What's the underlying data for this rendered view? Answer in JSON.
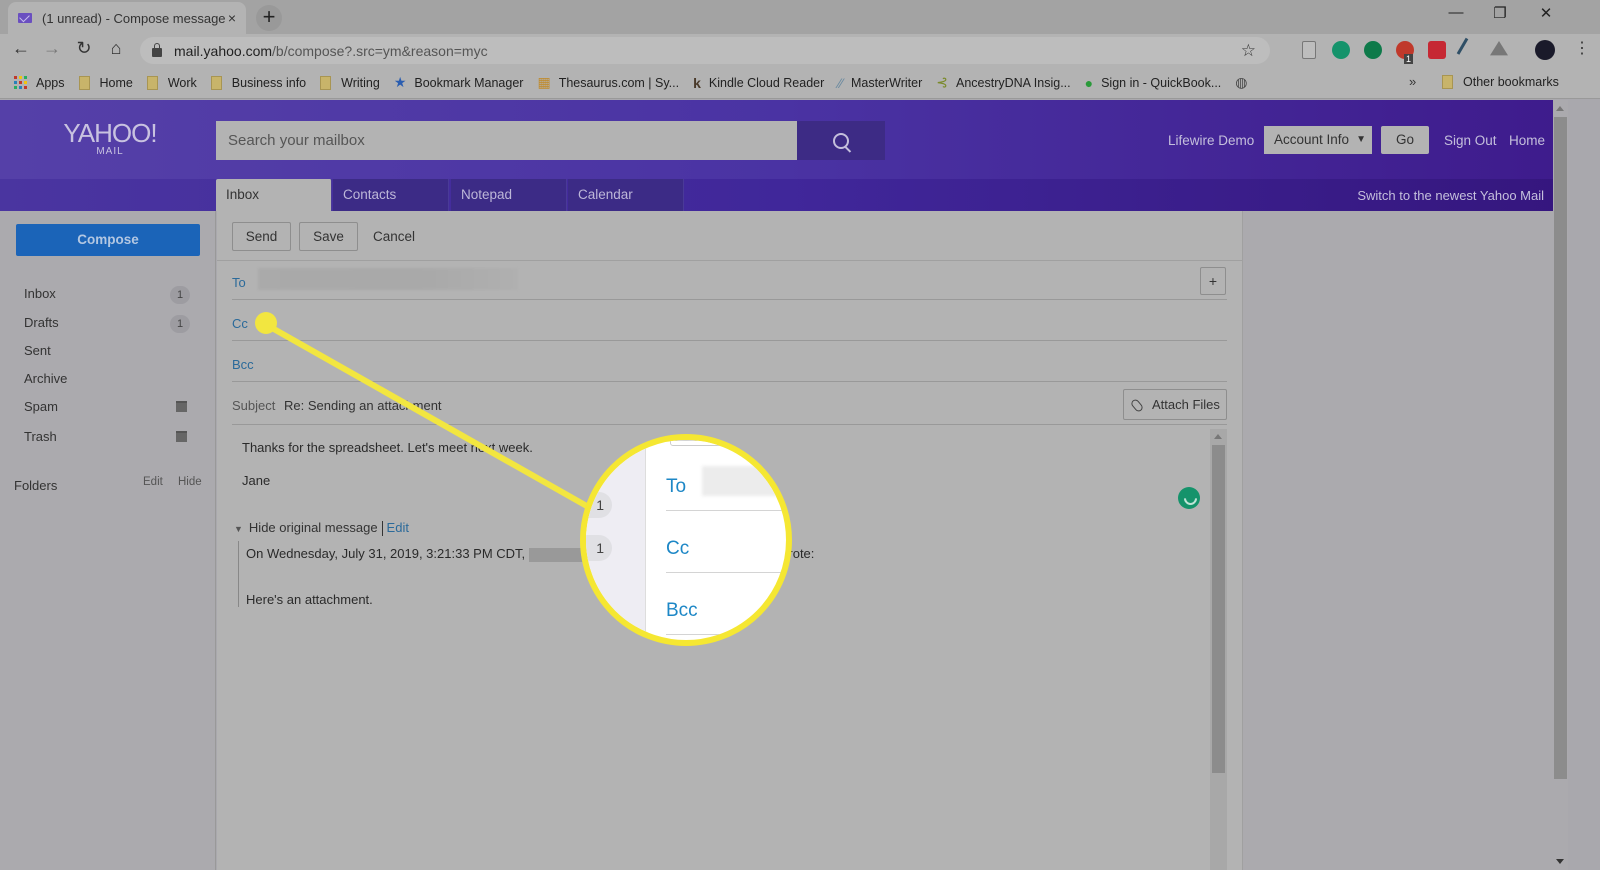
{
  "browser": {
    "tab_title": "(1 unread) - Compose message -",
    "tab_close": "×",
    "new_tab": "+",
    "window_controls": {
      "minimize": "—",
      "restore": "❐",
      "close": "✕"
    },
    "nav": {
      "back": "←",
      "forward": "→",
      "reload": "↻",
      "home": "⌂"
    },
    "url_host": "mail.yahoo.com",
    "url_path": "/b/compose?.src=ym&reason=myc",
    "star": "☆",
    "extensions": [
      {
        "name": "document-icon",
        "color": "#bdbdbd"
      },
      {
        "name": "grammarly-icon",
        "color": "#15936b"
      },
      {
        "name": "hangouts-icon",
        "color": "#0e7a4a"
      },
      {
        "name": "adblock-icon",
        "color": "#c0392b",
        "badge": "1"
      },
      {
        "name": "pocket-icon",
        "color": "#c62833"
      },
      {
        "name": "merge-icon",
        "color": "#2f4f66"
      },
      {
        "name": "drive-icon",
        "color": "#777"
      },
      {
        "name": "profile-avatar",
        "color": "#1a1a2a"
      }
    ],
    "menu": "⋮",
    "bookmarks": [
      {
        "label": "Apps",
        "icon": "apps-grid-icon"
      },
      {
        "label": "Home",
        "icon": "folder-icon"
      },
      {
        "label": "Work",
        "icon": "folder-icon"
      },
      {
        "label": "Business info",
        "icon": "folder-icon"
      },
      {
        "label": "Writing",
        "icon": "folder-icon"
      },
      {
        "label": "Bookmark Manager",
        "icon": "star-icon"
      },
      {
        "label": "Thesaurus.com | Sy...",
        "icon": "thesaurus-icon"
      },
      {
        "label": "Kindle Cloud Reader",
        "icon": "kindle-icon"
      },
      {
        "label": "MasterWriter",
        "icon": "masterwriter-icon"
      },
      {
        "label": "AncestryDNA Insig...",
        "icon": "ancestry-icon"
      },
      {
        "label": "Sign in - QuickBook...",
        "icon": "quickbooks-icon"
      },
      {
        "label": "",
        "icon": "globe-icon"
      }
    ],
    "overflow": "»",
    "other_bookmarks": "Other bookmarks"
  },
  "header": {
    "logo_main": "YAHOO!",
    "logo_sub": "MAIL",
    "search_placeholder": "Search your mailbox",
    "user_name": "Lifewire Demo",
    "account_select": "Account Info",
    "go_label": "Go",
    "sign_out": "Sign Out",
    "home": "Home",
    "tabs": [
      "Inbox",
      "Contacts",
      "Notepad",
      "Calendar"
    ],
    "active_tab": "Inbox",
    "switch_link": "Switch to the newest Yahoo Mail"
  },
  "sidebar": {
    "compose_label": "Compose",
    "folders": [
      {
        "label": "Inbox",
        "count": "1"
      },
      {
        "label": "Drafts",
        "count": "1"
      },
      {
        "label": "Sent"
      },
      {
        "label": "Archive"
      },
      {
        "label": "Spam",
        "action": "trash-icon"
      },
      {
        "label": "Trash",
        "action": "trash-icon"
      }
    ],
    "folders_heading": "Folders",
    "folders_edit": "Edit",
    "folders_hide": "Hide"
  },
  "compose": {
    "send_label": "Send",
    "save_label": "Save",
    "cancel_label": "Cancel",
    "to_label": "To",
    "cc_label": "Cc",
    "bcc_label": "Bcc",
    "add_recipient": "+",
    "subject_label": "Subject",
    "subject_value": "Re: Sending an attachment",
    "attach_label": "Attach Files",
    "body_line1": "Thanks for the spreadsheet. Let's meet next week.",
    "body_line2": "Jane",
    "hide_original": "Hide original message",
    "edit_original": "Edit",
    "quote_header": "On Wednesday, July 31, 2019, 3:21:33 PM CDT,",
    "quote_header_end": "wrote:",
    "quote_body": "Here's an attachment."
  },
  "callout": {
    "counts": [
      "1",
      "1"
    ],
    "fields": [
      "To",
      "Cc",
      "Bcc"
    ],
    "highlight_color": "#f5e732"
  }
}
